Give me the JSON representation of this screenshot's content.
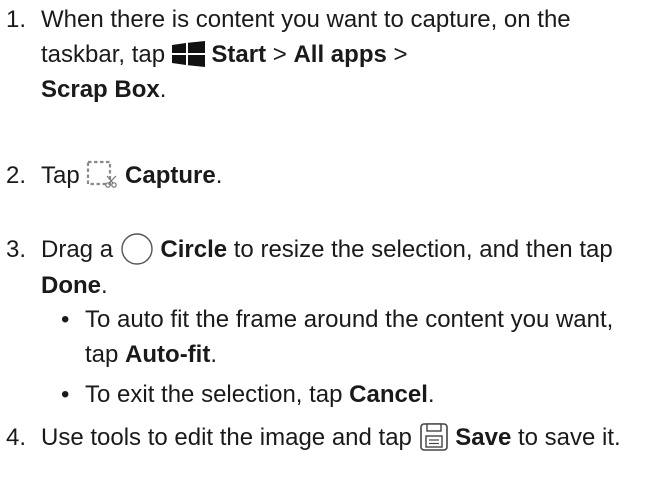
{
  "steps": [
    {
      "number": "1.",
      "text_a": "When there is content you want to capture, on the taskbar, tap",
      "start": "Start",
      "sep1": " > ",
      "all_apps": "All apps",
      "sep2": " >",
      "scrap_box": "Scrap Box",
      "end": ".",
      "icon": "windows-logo-icon"
    },
    {
      "number": "2.",
      "text_a": "Tap",
      "capture": "Capture",
      "end": ".",
      "icon": "capture-icon"
    },
    {
      "number": "3.",
      "text_a": "Drag a",
      "circle": "Circle",
      "text_b": " to resize the selection, and then tap",
      "done": "Done",
      "end": ".",
      "icon": "circle-icon"
    },
    {
      "number": "4.",
      "text_a": "Use tools to edit the image and tap",
      "save": "Save",
      "text_b": " to save it.",
      "icon": "save-icon"
    }
  ],
  "bullets": [
    {
      "dot": "•",
      "text_a": "To auto fit the frame around the content you want, tap",
      "auto_fit": "Auto-fit",
      "end": "."
    },
    {
      "dot": "•",
      "text_a": "To exit the selection, tap",
      "cancel": "Cancel",
      "end": "."
    }
  ]
}
